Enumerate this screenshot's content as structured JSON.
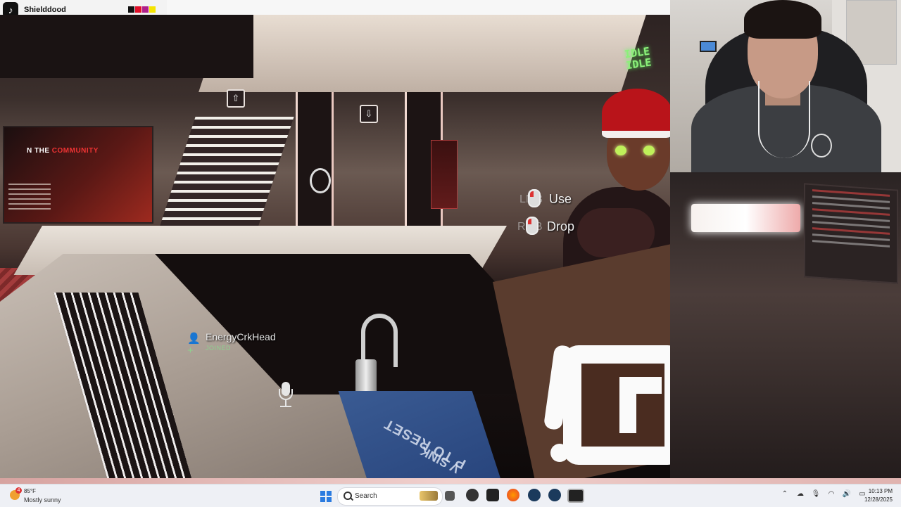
{
  "window": {
    "title": "Shielddood",
    "swatch_colors": [
      "#111111",
      "#e0102a",
      "#b0208a",
      "#f5e400"
    ]
  },
  "game": {
    "prompts": [
      {
        "key": "LMB",
        "label": "Use"
      },
      {
        "key": "RMB",
        "label": "Drop"
      }
    ],
    "notification": {
      "name": "EnergyCrkHead",
      "status": "JOINED"
    },
    "poster": {
      "title_prefix": "N THE",
      "title_highlight": "COMMUNITY"
    },
    "neon_sign": "IDLE IDLE",
    "sink_text_1": "P TO RESET",
    "sink_text_2": "V SINK"
  },
  "taskbar": {
    "weather": {
      "temperature": "85°F",
      "condition": "Mostly sunny",
      "badge": "4"
    },
    "search_placeholder": "Search",
    "apps": [
      "file-explorer-icon",
      "media-app-icon",
      "epic-games-icon",
      "firefox-icon",
      "steam-icon",
      "steam-icon-2",
      "vrchat-icon"
    ],
    "tray_icons": [
      "chevron-up-icon",
      "cloud-icon",
      "microphone-icon",
      "wifi-icon",
      "volume-icon",
      "battery-icon"
    ],
    "time": "10:13 PM",
    "date": "12/28/2025"
  }
}
